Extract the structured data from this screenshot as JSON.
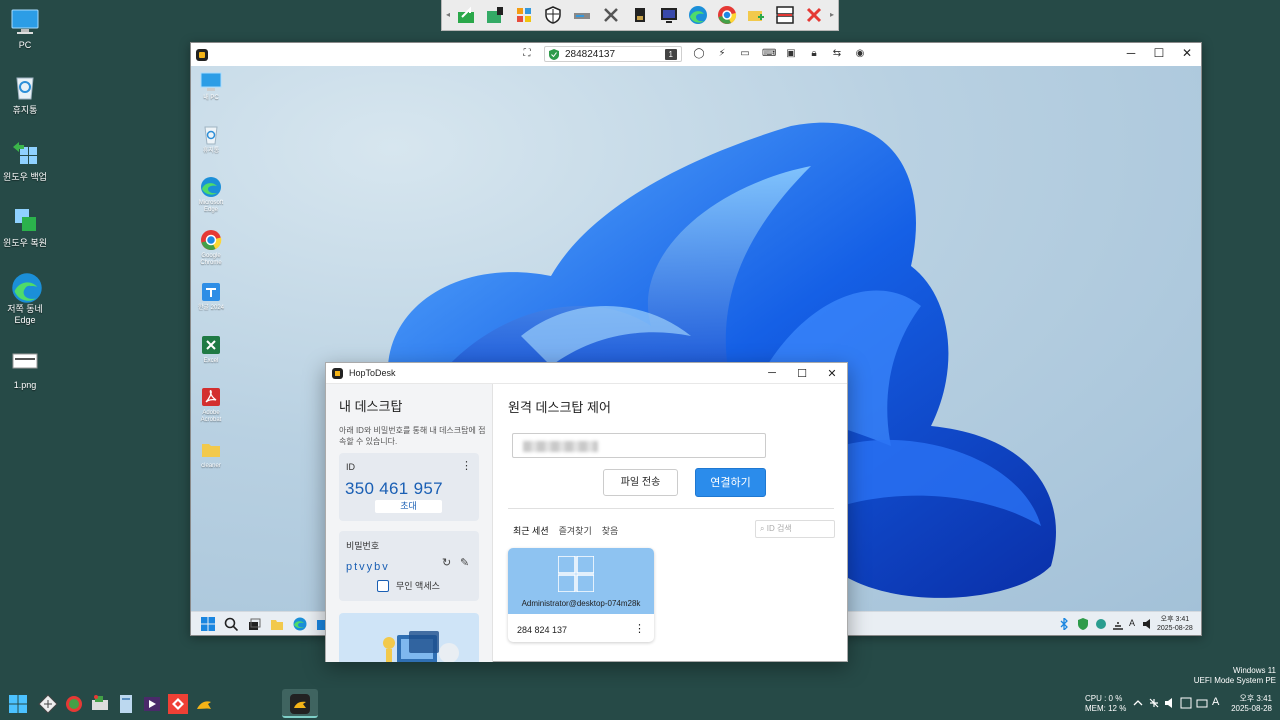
{
  "desktop_icons": [
    {
      "label": "PC",
      "icon": "monitor-icon"
    },
    {
      "label": "휴지통",
      "icon": "recycle-bin-icon"
    },
    {
      "label": "윈도우 백업",
      "icon": "backup-icon"
    },
    {
      "label": "윈도우 복원",
      "icon": "restore-icon"
    },
    {
      "label": "저쪽 동네 Edge",
      "icon": "edge-icon"
    },
    {
      "label": "1.png",
      "icon": "image-file-icon"
    }
  ],
  "quick_toolbar": [
    "share-icon",
    "network-icon",
    "registry-icon",
    "shield-icon",
    "disk-icon",
    "tools-icon",
    "sdcard-icon",
    "display-icon",
    "edge-icon",
    "chrome-icon",
    "folder-add-icon",
    "split-icon",
    "close-x-icon"
  ],
  "remote_window": {
    "session_id": "284824137",
    "monitor_number": "1",
    "tools": [
      "chat-icon",
      "lightning-icon",
      "display-icon",
      "keyboard-icon",
      "record-icon",
      "lock-icon",
      "transfer-icon",
      "eye-icon"
    ],
    "controls": {
      "minimize": "─",
      "maximize": "☐",
      "close": "✕"
    },
    "remote_desktop_icons": [
      {
        "label": "내 PC"
      },
      {
        "label": "휴지통"
      },
      {
        "label": "Microsoft Edge"
      },
      {
        "label": "Google Chrome"
      },
      {
        "label": "한글 2024"
      },
      {
        "label": "Excel"
      },
      {
        "label": "Adobe Acrobat"
      },
      {
        "label": "cleaner"
      }
    ],
    "remote_tray_time": "오후 3:41",
    "remote_tray_date": "2025-08-28",
    "remote_tray_ime": "A"
  },
  "hoptodesk": {
    "title": "HopToDesk",
    "controls": {
      "minimize": "─",
      "maximize": "☐",
      "close": "✕"
    },
    "left": {
      "heading": "내 데스크탑",
      "description": "아래 ID와 비밀번호를 통해 내 데스크탑에 접속할 수 있습니다.",
      "id_label": "ID",
      "id_value": "350 461 957",
      "invite_label": "초대",
      "password_label": "비밀번호",
      "password_value": "ptvybv",
      "unattended_label": "무인 액세스",
      "unattended_checked": false
    },
    "right": {
      "heading": "원격 데스크탑 제어",
      "file_transfer_label": "파일 전송",
      "connect_label": "연결하기",
      "tabs": [
        "최근 세션",
        "즐겨찾기",
        "찾음"
      ],
      "search_placeholder": "ID 검색",
      "session": {
        "host": "Administrator@desktop-074m28k",
        "id": "284 824 137"
      }
    },
    "accent_color": "#2b8ceb"
  },
  "system_info": {
    "line1": "Windows 11",
    "line2": "UEFI Mode System PE"
  },
  "tray": {
    "cpu": "CPU :   0 %",
    "mem": "MEM:  12 %",
    "ime": "A"
  },
  "clock": {
    "time": "오후 3:41",
    "date": "2025-08-28"
  }
}
